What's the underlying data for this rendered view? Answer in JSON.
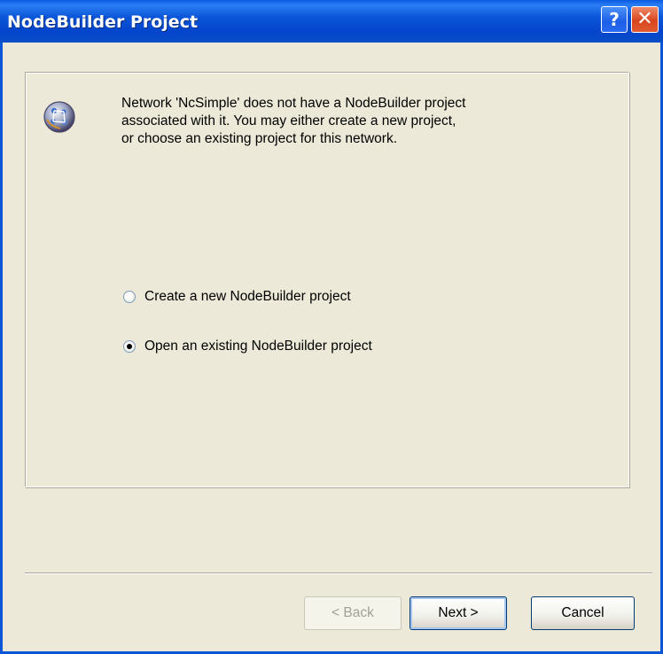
{
  "window": {
    "title": "NodeBuilder Project",
    "help_label": "?",
    "close_label": "✕"
  },
  "message": {
    "line1": "Network 'NcSimple' does not have a NodeBuilder project",
    "line2": "associated with it. You may either create a new project,",
    "line3": "or choose an existing project for this network."
  },
  "options": {
    "create_new": {
      "label": "Create a new NodeBuilder project",
      "selected": false
    },
    "open_existing": {
      "label": "Open an existing NodeBuilder project",
      "selected": true
    }
  },
  "buttons": {
    "back": "< Back",
    "next": "Next >",
    "cancel": "Cancel"
  },
  "icons": {
    "app": "network-globe-icon",
    "help": "help-icon",
    "close": "close-icon"
  },
  "colors": {
    "titlebar": "#0b56d8",
    "dialog_bg": "#ece9d8",
    "close_button": "#d8461e"
  }
}
